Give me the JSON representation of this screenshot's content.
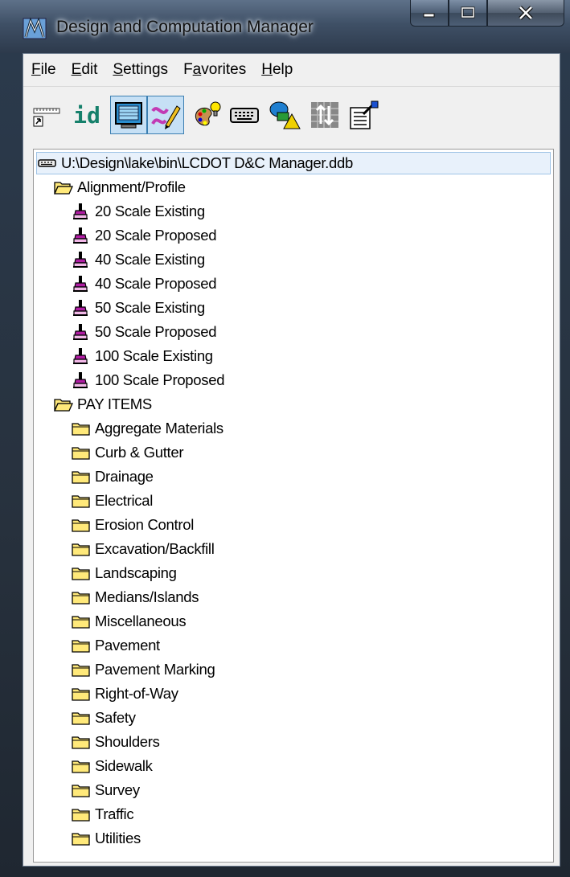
{
  "window": {
    "title": "Design and Computation Manager",
    "controls": {
      "minimize": "minimize",
      "maximize": "maximize",
      "close": "close"
    }
  },
  "menu": {
    "items": [
      {
        "label": "File",
        "accel": "F",
        "rest": "ile"
      },
      {
        "label": "Edit",
        "accel": "E",
        "rest": "dit"
      },
      {
        "label": "Settings",
        "accel": "S",
        "rest": "ettings"
      },
      {
        "label": "Favorites",
        "pre": "F",
        "accel": "a",
        "rest": "vorites"
      },
      {
        "label": "Help",
        "accel": "H",
        "rest": "elp"
      }
    ]
  },
  "toolbar": {
    "buttons": [
      {
        "icon": "ruler-shortcut-icon",
        "pressed": false
      },
      {
        "icon": "id-icon",
        "label": "id",
        "pressed": false
      },
      {
        "icon": "monitor-icon",
        "pressed": true
      },
      {
        "icon": "draw-pencil-icon",
        "pressed": true
      },
      {
        "icon": "palette-icon",
        "pressed": false
      },
      {
        "icon": "keyboard-icon",
        "pressed": false
      },
      {
        "icon": "shapes-icon",
        "pressed": false
      },
      {
        "icon": "grid-arrows-icon",
        "pressed": false
      },
      {
        "icon": "properties-icon",
        "pressed": false
      }
    ]
  },
  "tree": {
    "root": {
      "label": "U:\\Design\\lake\\bin\\LCDOT D&C Manager.ddb",
      "icon": "database-icon",
      "selected": true
    },
    "groups": [
      {
        "label": "Alignment/Profile",
        "icon": "open-folder-icon",
        "items": [
          "20 Scale Existing",
          "20 Scale Proposed",
          "40 Scale Existing",
          "40 Scale Proposed",
          "50 Scale Existing",
          "50 Scale Proposed",
          "100 Scale Existing",
          "100 Scale Proposed"
        ],
        "item_icon": "brush-icon"
      },
      {
        "label": "PAY ITEMS",
        "icon": "open-folder-icon",
        "items": [
          "Aggregate Materials",
          "Curb & Gutter",
          "Drainage",
          "Electrical",
          "Erosion Control",
          "Excavation/Backfill",
          "Landscaping",
          "Medians/Islands",
          "Miscellaneous",
          "Pavement",
          "Pavement Marking",
          "Right-of-Way",
          "Safety",
          "Shoulders",
          "Sidewalk",
          "Survey",
          "Traffic",
          "Utilities"
        ],
        "item_icon": "folder-icon"
      }
    ]
  },
  "colors": {
    "folder_yellow": "#ffe97a",
    "brush_purple": "#b01ca3",
    "selection": "#e8f1fb"
  }
}
